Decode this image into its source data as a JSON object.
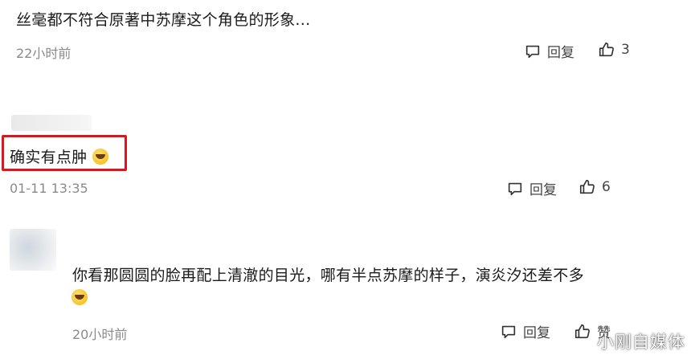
{
  "comments": [
    {
      "text": "丝毫都不符合原著中苏摩这个角色的形象...",
      "time": "22小时前",
      "reply_label": "回复",
      "like_count": "3"
    },
    {
      "text": "确实有点肿",
      "time": "01-11 13:35",
      "reply_label": "回复",
      "like_count": "6"
    },
    {
      "text": "你看那圆圆的脸再配上清澈的目光，哪有半点苏摩的样子，演炎汐还差不多",
      "time": "20小时前",
      "reply_label": "回复",
      "like_label": "赞"
    }
  ],
  "watermark": "小刚自媒体",
  "colors": {
    "highlight": "#d7181f",
    "meta": "#8a8a8a",
    "emoji": "#f5b400"
  },
  "icons": [
    "comment-icon",
    "thumbs-up-icon",
    "laugh-cry-emoji-icon"
  ]
}
